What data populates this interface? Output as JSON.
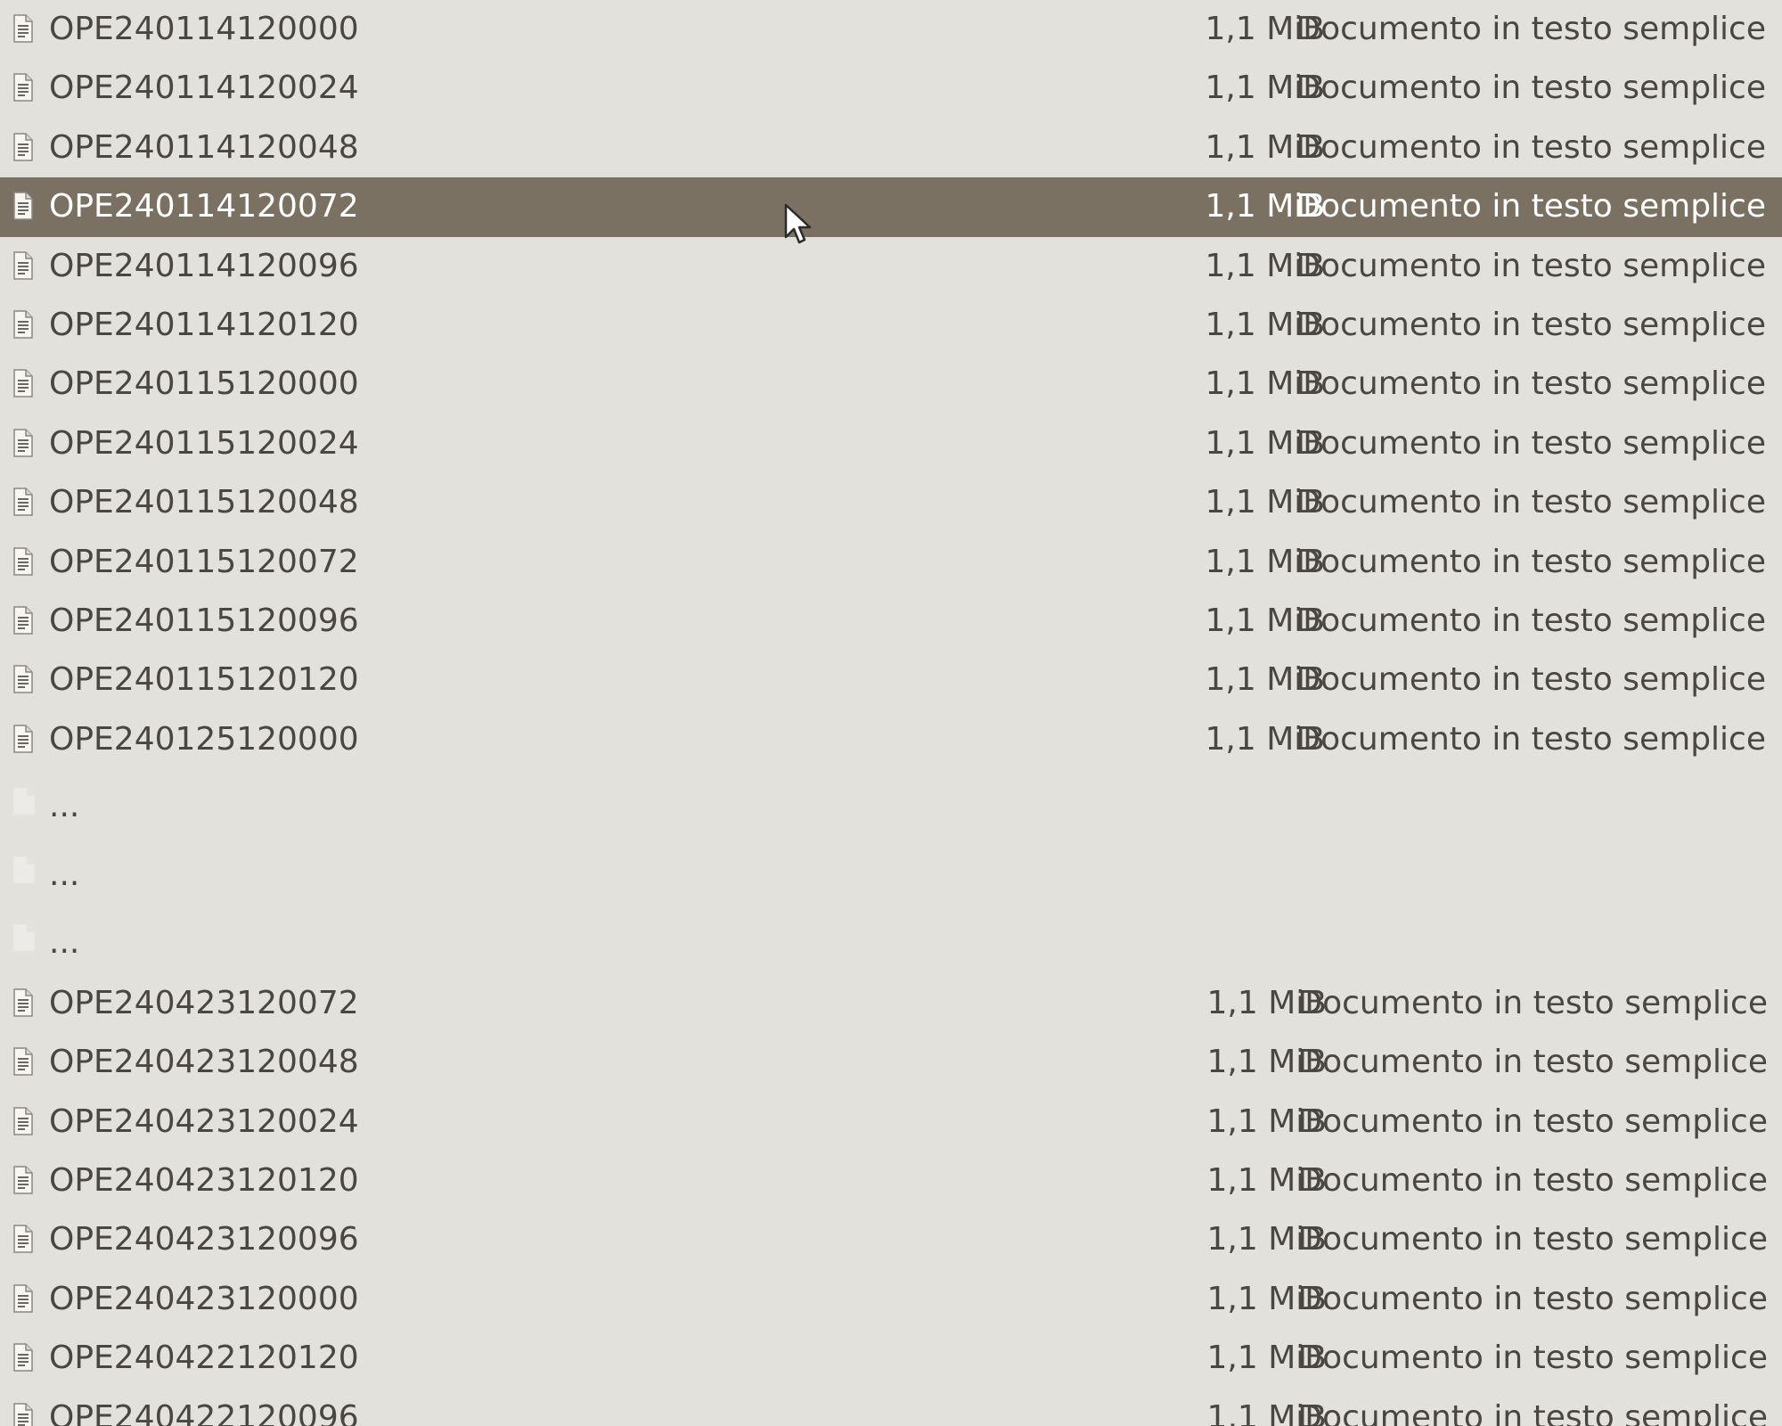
{
  "file_list": {
    "rows_top": [
      {
        "name": "OPE240114120000",
        "size": "1,1 MiB",
        "type": "Documento in testo semplice",
        "selected": false
      },
      {
        "name": "OPE240114120024",
        "size": "1,1 MiB",
        "type": "Documento in testo semplice",
        "selected": false
      },
      {
        "name": "OPE240114120048",
        "size": "1,1 MiB",
        "type": "Documento in testo semplice",
        "selected": false
      },
      {
        "name": "OPE240114120072",
        "size": "1,1 MiB",
        "type": "Documento in testo semplice",
        "selected": true
      },
      {
        "name": "OPE240114120096",
        "size": "1,1 MiB",
        "type": "Documento in testo semplice",
        "selected": false
      },
      {
        "name": "OPE240114120120",
        "size": "1,1 MiB",
        "type": "Documento in testo semplice",
        "selected": false
      },
      {
        "name": "OPE240115120000",
        "size": "1,1 MiB",
        "type": "Documento in testo semplice",
        "selected": false
      },
      {
        "name": "OPE240115120024",
        "size": "1,1 MiB",
        "type": "Documento in testo semplice",
        "selected": false
      },
      {
        "name": "OPE240115120048",
        "size": "1,1 MiB",
        "type": "Documento in testo semplice",
        "selected": false
      },
      {
        "name": "OPE240115120072",
        "size": "1,1 MiB",
        "type": "Documento in testo semplice",
        "selected": false
      },
      {
        "name": "OPE240115120096",
        "size": "1,1 MiB",
        "type": "Documento in testo semplice",
        "selected": false
      },
      {
        "name": "OPE240115120120",
        "size": "1,1 MiB",
        "type": "Documento in testo semplice",
        "selected": false
      },
      {
        "name": "OPE240125120000",
        "size": "1,1 MiB",
        "type": "Documento in testo semplice",
        "selected": false
      }
    ],
    "placeholders": [
      {
        "name": "..."
      },
      {
        "name": "..."
      },
      {
        "name": "..."
      }
    ],
    "rows_bottom": [
      {
        "name": "OPE240423120072",
        "size": "1,1 MiB",
        "type": "Documento in testo semplice",
        "selected": false
      },
      {
        "name": "OPE240423120048",
        "size": "1,1 MiB",
        "type": "Documento in testo semplice",
        "selected": false
      },
      {
        "name": "OPE240423120024",
        "size": "1,1 MiB",
        "type": "Documento in testo semplice",
        "selected": false
      },
      {
        "name": "OPE240423120120",
        "size": "1,1 MiB",
        "type": "Documento in testo semplice",
        "selected": false
      },
      {
        "name": "OPE240423120096",
        "size": "1,1 MiB",
        "type": "Documento in testo semplice",
        "selected": false
      },
      {
        "name": "OPE240423120000",
        "size": "1,1 MiB",
        "type": "Documento in testo semplice",
        "selected": false
      },
      {
        "name": "OPE240422120120",
        "size": "1,1 MiB",
        "type": "Documento in testo semplice",
        "selected": false
      },
      {
        "name": "OPE240422120096",
        "size": "1,1 MiB",
        "type": "Documento in testo semplice",
        "selected": false
      }
    ],
    "icons": {
      "file": "text-document-icon",
      "placeholder": "blank-document-icon",
      "pointer": "mouse-pointer-icon"
    },
    "colors": {
      "background": "#e2e1dc",
      "selected_background": "#7b7163",
      "text": "#4a4640",
      "selected_text": "#ffffff"
    }
  }
}
